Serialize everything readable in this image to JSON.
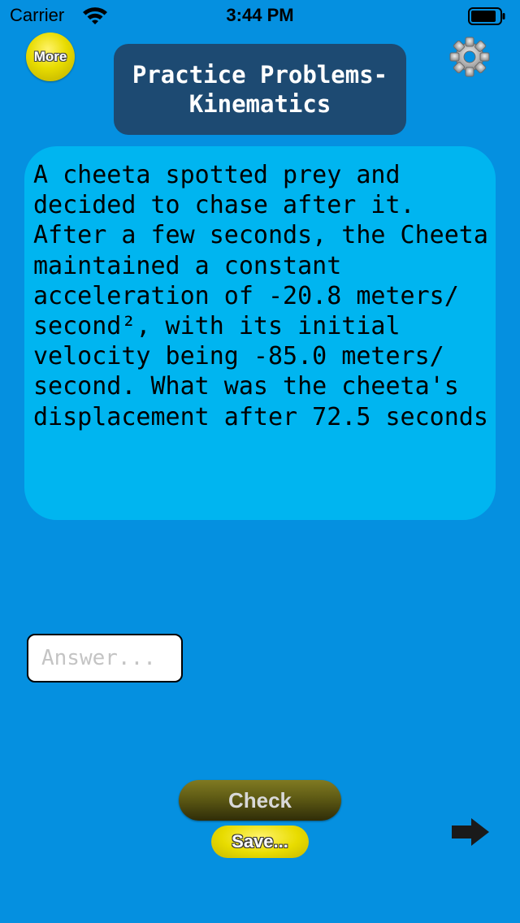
{
  "status_bar": {
    "carrier": "Carrier",
    "time": "3:44 PM"
  },
  "header": {
    "more_label": "More",
    "title": "Practice Problems-\nKinematics",
    "settings_icon": "gear-icon"
  },
  "problem": {
    "text": "A cheeta spotted prey and decided to chase after it. After a few seconds, the Cheeta maintained a constant acceleration of -20.8 meters/ second², with its initial velocity being -85.0 meters/ second. What was the cheeta's displacement after 72.5 seconds"
  },
  "answer": {
    "value": "",
    "placeholder": "Answer..."
  },
  "actions": {
    "check_label": "Check",
    "save_label": "Save...",
    "next_icon": "arrow-right-icon"
  },
  "colors": {
    "background": "#0590e0",
    "title_panel": "#1d4a72",
    "problem_card": "#00b5f0",
    "more_button": "#e8dc00",
    "check_button": "#5e5a14",
    "save_button": "#e8dc00"
  }
}
